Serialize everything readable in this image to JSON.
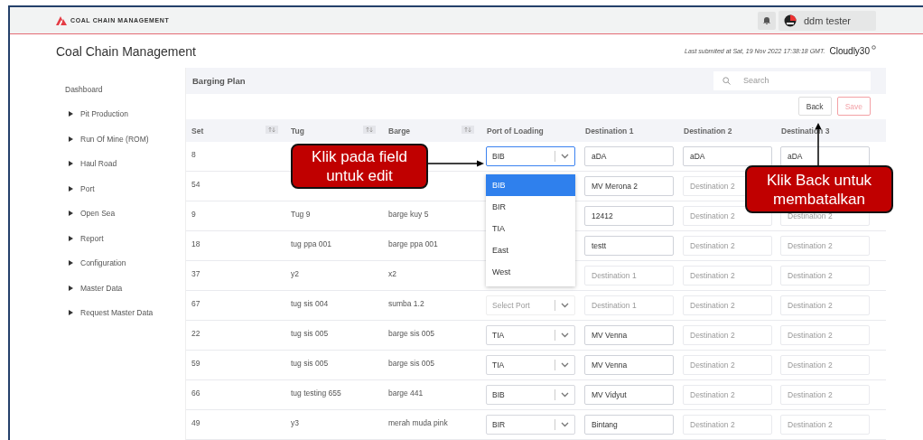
{
  "brand": {
    "name": "COAL CHAIN MANAGEMENT"
  },
  "user": {
    "name": "ddm tester"
  },
  "header": {
    "title": "Coal Chain Management",
    "last_submitted": "Last submited at Sat, 19 Nov 2022 17:38:18 GMT.",
    "account": "Cloudly30"
  },
  "sidebar": {
    "items": [
      {
        "label": "Dashboard",
        "kind": "link"
      },
      {
        "label": "Pit Production",
        "kind": "group"
      },
      {
        "label": "Run Of Mine (ROM)",
        "kind": "group"
      },
      {
        "label": "Haul Road",
        "kind": "group"
      },
      {
        "label": "Port",
        "kind": "group"
      },
      {
        "label": "Open Sea",
        "kind": "group"
      },
      {
        "label": "Report",
        "kind": "group"
      },
      {
        "label": "Configuration",
        "kind": "group"
      },
      {
        "label": "Master Data",
        "kind": "group"
      },
      {
        "label": "Request Master Data",
        "kind": "group"
      }
    ]
  },
  "panel": {
    "title": "Barging Plan",
    "search": {
      "placeholder": "Search"
    },
    "buttons": [
      {
        "label": "Back",
        "kind": "default",
        "disabled": false
      },
      {
        "label": "Save",
        "kind": "danger",
        "disabled": true
      }
    ]
  },
  "table": {
    "columns": [
      {
        "label": "Set",
        "sortable": true
      },
      {
        "label": "Tug",
        "sortable": true
      },
      {
        "label": "Barge",
        "sortable": true
      },
      {
        "label": "Port of Loading",
        "sortable": false
      },
      {
        "label": "Destination 1",
        "sortable": false
      },
      {
        "label": "Destination 2",
        "sortable": false
      },
      {
        "label": "Destination 3",
        "sortable": false
      }
    ],
    "rows": [
      {
        "set": "8",
        "port": {
          "value": "BIB",
          "focused": true,
          "options": [
            {
              "label": "BIB",
              "selected": true
            },
            {
              "label": "BIR",
              "selected": false
            },
            {
              "label": "TIA",
              "selected": false
            },
            {
              "label": "East",
              "selected": false
            },
            {
              "label": "West",
              "selected": false
            }
          ]
        },
        "destinations": [
          {
            "value": "aDA"
          },
          {
            "value": "aDA"
          },
          {
            "value": "aDA"
          }
        ]
      },
      {
        "set": "54",
        "port": {},
        "destinations": [
          {
            "value": "MV Merona 2"
          },
          {
            "placeholder": "Destination 2"
          }
        ]
      },
      {
        "set": "9",
        "tug": "Tug 9",
        "barge": "barge kuy 5",
        "port": {},
        "destinations": [
          {
            "value": "12412"
          },
          {
            "placeholder": "Destination 2"
          },
          {
            "placeholder": "Destination 2"
          }
        ]
      },
      {
        "set": "18",
        "tug": "tug ppa 001",
        "barge": "barge ppa 001",
        "port": {},
        "destinations": [
          {
            "value": "testt"
          },
          {
            "placeholder": "Destination 2"
          },
          {
            "placeholder": "Destination 2"
          }
        ]
      },
      {
        "set": "37",
        "tug": "y2",
        "barge": "x2",
        "port": {},
        "destinations": [
          {
            "placeholder": "Destination 1"
          },
          {
            "placeholder": "Destination 2"
          },
          {
            "placeholder": "Destination 2"
          }
        ]
      },
      {
        "set": "67",
        "tug": "tug sis 004",
        "barge": "sumba 1.2",
        "port": {
          "placeholder": "Select Port"
        },
        "destinations": [
          {
            "placeholder": "Destination 1"
          },
          {
            "placeholder": "Destination 2"
          },
          {
            "placeholder": "Destination 2"
          }
        ]
      },
      {
        "set": "22",
        "tug": "tug sis 005",
        "barge": "barge sis 005",
        "port": {
          "value": "TIA"
        },
        "destinations": [
          {
            "value": "MV Venna"
          },
          {
            "placeholder": "Destination 2"
          },
          {
            "placeholder": "Destination 2"
          }
        ]
      },
      {
        "set": "59",
        "tug": "tug sis 005",
        "barge": "barge sis 005",
        "port": {
          "value": "TIA"
        },
        "destinations": [
          {
            "value": "MV Venna"
          },
          {
            "placeholder": "Destination 2"
          },
          {
            "placeholder": "Destination 2"
          }
        ]
      },
      {
        "set": "66",
        "tug": "tug testing 655",
        "barge": "barge 441",
        "port": {
          "value": "BIB"
        },
        "destinations": [
          {
            "value": "MV Vidyut"
          },
          {
            "placeholder": "Destination 2"
          },
          {
            "placeholder": "Destination 2"
          }
        ]
      },
      {
        "set": "49",
        "tug": "y3",
        "barge": "merah muda pink",
        "port": {
          "value": "BIR"
        },
        "destinations": [
          {
            "value": "Bintang"
          },
          {
            "placeholder": "Destination 2"
          },
          {
            "placeholder": "Destination 2"
          }
        ]
      }
    ]
  },
  "callouts": [
    {
      "text": "Klik pada field untuk edit",
      "kind": "left"
    },
    {
      "text": "Klik Back untuk membatalkan",
      "kind": "up"
    }
  ]
}
